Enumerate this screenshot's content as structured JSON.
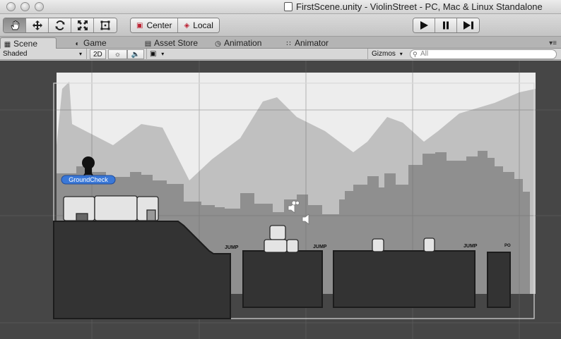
{
  "window": {
    "title": "FirstScene.unity - ViolinStreet - PC, Mac & Linux Standalone"
  },
  "toolbar": {
    "tools": [
      {
        "name": "hand-tool-icon",
        "active": true
      },
      {
        "name": "move-tool-icon",
        "active": false
      },
      {
        "name": "rotate-tool-icon",
        "active": false
      },
      {
        "name": "scale-tool-icon",
        "active": false
      },
      {
        "name": "rect-tool-icon",
        "active": false
      }
    ],
    "pivot_label": "Center",
    "space_label": "Local",
    "playback": [
      "play-icon",
      "pause-icon",
      "step-icon"
    ]
  },
  "tabs": [
    {
      "label": "Scene",
      "icon": "scene-icon",
      "active": true
    },
    {
      "label": "Game",
      "icon": "game-icon",
      "active": false
    },
    {
      "label": "Asset Store",
      "icon": "asset-store-icon",
      "active": false
    },
    {
      "label": "Animation",
      "icon": "animation-icon",
      "active": false
    },
    {
      "label": "Animator",
      "icon": "animator-icon",
      "active": false
    }
  ],
  "scenebar": {
    "draw_mode": "Shaded",
    "mode_2d": "2D",
    "gizmos": "Gizmos",
    "search_placeholder": "All"
  },
  "scene": {
    "ground_check_label": "GroundCheck",
    "jump_labels": [
      "JUMP",
      "JUMP",
      "JUMP"
    ],
    "partial_label": "PO",
    "colors": {
      "background": "#464646",
      "sky": "#e8e8e8",
      "far_hills": "#bfbfbf",
      "buildings": "#8f8f8f",
      "ground": "#333333"
    }
  }
}
